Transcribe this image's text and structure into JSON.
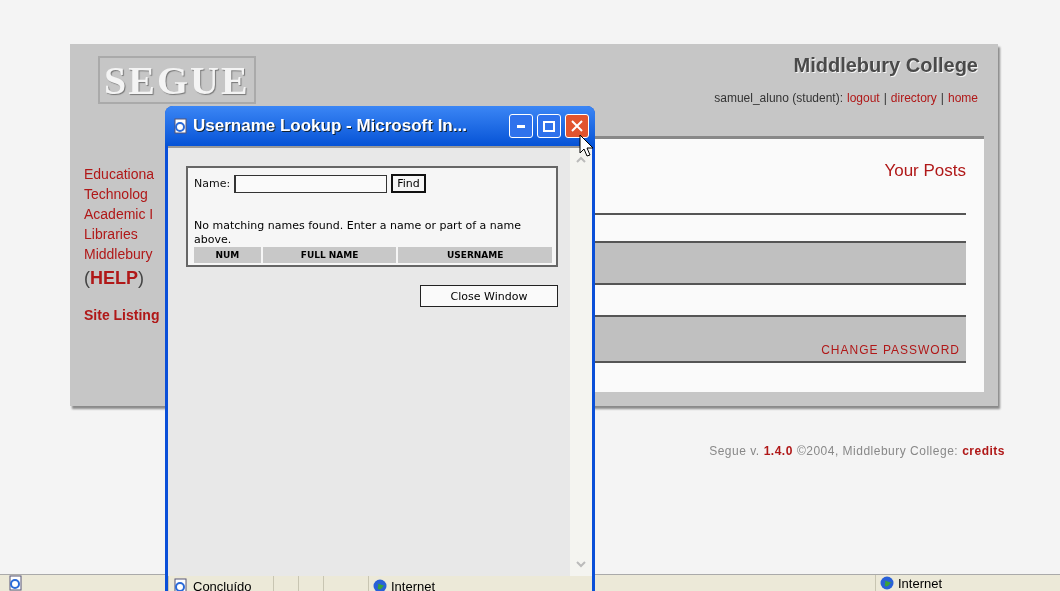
{
  "page": {
    "logo": "SEGUE",
    "site_title": "Middlebury College",
    "user": "samuel_aluno (student):",
    "link_separator": "|",
    "user_links": [
      "logout",
      "directory",
      "home"
    ],
    "sidebar": [
      "Educationa",
      "Technolog",
      "Academic I",
      "Libraries",
      "Middlebury"
    ],
    "help_open": "(",
    "help": "HELP",
    "help_close": ")",
    "site_listing": "Site Listing",
    "your_posts": "Your Posts",
    "change_password": "CHANGE PASSWORD",
    "footer": {
      "prefix": "Segue v.",
      "version": "1.4.0",
      "middle": "©2004, Middlebury College:",
      "credits": "credits"
    }
  },
  "popup": {
    "title": "Username Lookup - Microsoft In...",
    "name_label": "Name:",
    "find": "Find",
    "message": "No matching names found. Enter a name or part of a name above.",
    "columns": [
      "NUM",
      "FULL NAME",
      "USERNAME"
    ],
    "close": "Close Window",
    "status": "Concluído",
    "zone": "Internet"
  },
  "status_bar": {
    "zone": "Internet"
  }
}
